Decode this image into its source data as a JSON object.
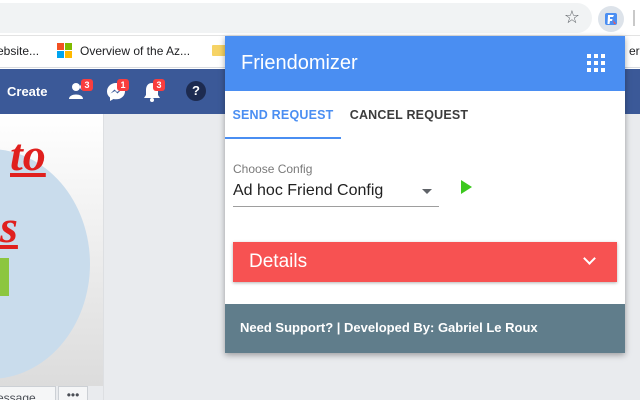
{
  "browser": {
    "bookmarks": [
      "ebsite...",
      "Overview of the Az...",
      "er l"
    ]
  },
  "fb": {
    "create_label": "Create",
    "badges": {
      "friends": "3",
      "messages": "1",
      "notifications": "3"
    },
    "help_label": "?",
    "cover_text_1": "to",
    "cover_text_2": "s",
    "message_button": "essage",
    "more_button": "•••"
  },
  "popup": {
    "title": "Friendomizer",
    "tabs": [
      {
        "label": "SEND REQUEST",
        "active": true
      },
      {
        "label": "CANCEL REQUEST",
        "active": false
      }
    ],
    "config_label": "Choose Config",
    "config_value": "Ad hoc Friend Config",
    "details_label": "Details",
    "footer": "Need Support? | Developed By: Gabriel Le Roux"
  },
  "colors": {
    "header": "#4a8ef2",
    "details": "#f75252",
    "footer": "#607d8b",
    "play": "#3cc81e",
    "fb_nav": "#3b5998"
  },
  "icons": [
    "star-icon",
    "extension-icon",
    "apps-grid-icon",
    "dropdown-caret-icon",
    "play-icon",
    "chevron-down-icon"
  ]
}
